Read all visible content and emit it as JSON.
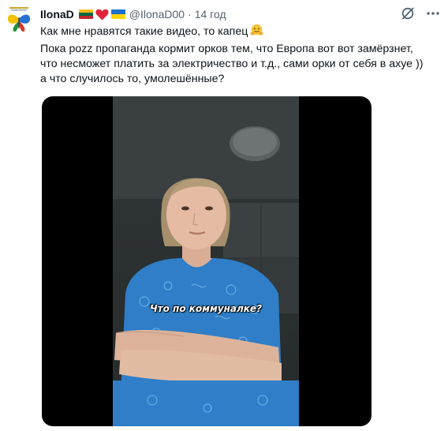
{
  "tweet": {
    "display_name": "IlonaD",
    "handle": "@IlonaD00",
    "separator": "·",
    "time": "14 год",
    "lines": [
      "Как мне нравятся такие видео, то капец",
      "Пока pozz пропаганда кормит орков тем, что Европа вот вот замёрзнет,",
      "что несможет платить за электричество и т.д., сами орки от себя в ахуе ))",
      "а что случилось то, умолешённые?"
    ]
  },
  "video": {
    "caption": "Что по коммуналке?"
  },
  "colors": {
    "text": "#0f1419",
    "secondary": "#536471",
    "shirt": "#2f7ec7"
  }
}
